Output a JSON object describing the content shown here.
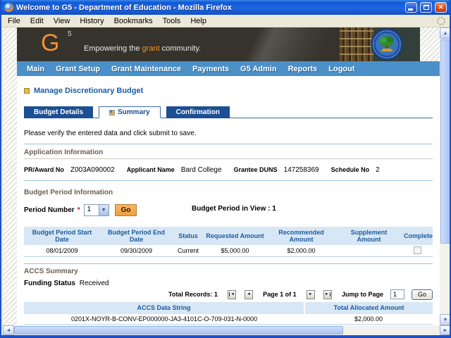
{
  "window": {
    "title": "Welcome to G5 - Department of Education - Mozilla Firefox",
    "menu": [
      "File",
      "Edit",
      "View",
      "History",
      "Bookmarks",
      "Tools",
      "Help"
    ]
  },
  "banner": {
    "logo_letter": "G",
    "logo_sup": "5",
    "tagline_prefix": "Empowering the ",
    "tagline_highlight": "grant",
    "tagline_suffix": " community."
  },
  "nav": {
    "items": [
      "Main",
      "Grant Setup",
      "Grant Maintenance",
      "Payments",
      "G5 Admin",
      "Reports",
      "Logout"
    ]
  },
  "page": {
    "title": "Manage Discretionary Budget",
    "tabs": [
      {
        "label": "Budget Details"
      },
      {
        "label": "Summary"
      },
      {
        "label": "Confirmation"
      }
    ],
    "instruction": "Please verify the entered data and click submit to save."
  },
  "application_information": {
    "title": "Application Information",
    "fields": [
      {
        "label": "PR/Award No",
        "value": "Z003A090002"
      },
      {
        "label": "Applicant Name",
        "value": "Bard College"
      },
      {
        "label": "Grantee DUNS",
        "value": "147258369"
      },
      {
        "label": "Schedule No",
        "value": "2"
      }
    ]
  },
  "budget_period": {
    "title": "Budget Period Information",
    "period_number_label": "Period Number",
    "required_marker": "*",
    "period_value": "1",
    "go_button": "Go",
    "in_view_text": "Budget Period in View : 1",
    "table": {
      "headers": [
        "Budget Period Start Date",
        "Budget Period End Date",
        "Status",
        "Requested Amount",
        "Recommended Amount",
        "Supplement Amount",
        "Complete"
      ],
      "row": {
        "start_date": "08/01/2009",
        "end_date": "09/30/2009",
        "status": "Current",
        "requested_amount": "$5,000.00",
        "recommended_amount": "$2,000.00",
        "supplement_amount": ""
      }
    }
  },
  "accs_summary": {
    "title": "ACCS Summary",
    "funding_status_label": "Funding Status",
    "funding_status_value": "Received",
    "pagination": {
      "total_records": "Total Records: 1",
      "page_text": "Page 1 of 1",
      "jump_label": "Jump to Page",
      "jump_value": "1",
      "go_button": "Go"
    },
    "table": {
      "headers": [
        "ACCS Data String",
        "Total Allocated Amount"
      ],
      "row": {
        "accs_data_string": "0201X-NOYR-B-CONV-EP000000-JA3-4101C-O-709-031-N-0000",
        "total_allocated_amount": "$2,000.00"
      }
    }
  },
  "icons": {
    "close": "✕",
    "first_page": "◄",
    "prev_page": "◄",
    "next_page": "►",
    "last_page": "►",
    "scroll_up": "▲",
    "scroll_down": "▼",
    "scroll_left": "◄",
    "scroll_right": "►",
    "dropdown": "▼"
  }
}
